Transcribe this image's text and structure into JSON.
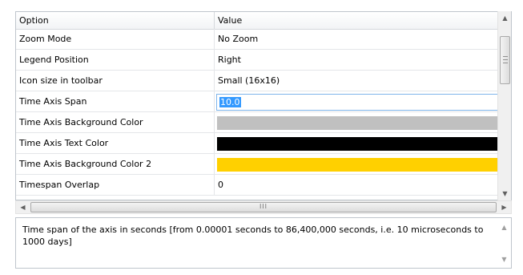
{
  "grid": {
    "header": {
      "option": "Option",
      "value": "Value"
    },
    "rows": [
      {
        "option": "Zoom Mode",
        "value": "No Zoom"
      },
      {
        "option": "Legend Position",
        "value": "Right"
      },
      {
        "option": "Icon size in toolbar",
        "value": "Small (16x16)"
      },
      {
        "option": "Time Axis Span",
        "value": "10.0"
      },
      {
        "option": "Time Axis Background Color",
        "color": "#c0c0c0"
      },
      {
        "option": "Time Axis Text Color",
        "color": "#000000"
      },
      {
        "option": "Time Axis Background Color 2",
        "color": "#ffd000"
      },
      {
        "option": "Timespan Overlap",
        "value": "0"
      }
    ],
    "selected_row": "Time Axis Span"
  },
  "scrollbars": {
    "up_arrow": "▲",
    "down_arrow": "▼",
    "left_arrow": "◀",
    "right_arrow": "▶",
    "h_thumb_grip": "III",
    "v_thumb_grip": "≡"
  },
  "description": {
    "text": "Time span of the axis in seconds [from 0.00001 seconds to 86,400,000 seconds, i.e. 10 microseconds to 1000 days]"
  },
  "colors": {
    "edit_border": "#7eb4ea",
    "selection": "#3399ff"
  }
}
